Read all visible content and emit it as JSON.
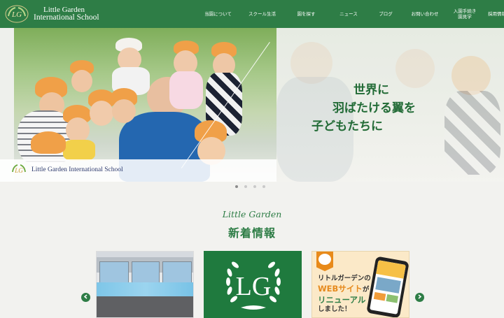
{
  "header": {
    "logo_line1": "Little Garden",
    "logo_line2": "International School",
    "background_color": "#2e7d46",
    "nav": [
      {
        "label": "当園について",
        "icon": null
      },
      {
        "label": "スクール生活",
        "icon": null
      },
      {
        "label": "園を探す",
        "icon": null
      },
      {
        "label": "ニュース",
        "icon": null
      },
      {
        "label": "ブログ",
        "icon": null
      },
      {
        "label": "お問い合わせ",
        "icon": null
      },
      {
        "label": "入園手続き\n園見学",
        "icon": null
      },
      {
        "label": "採用情報",
        "icon": "external-link-icon"
      }
    ]
  },
  "hero": {
    "copy_line1": "世界に",
    "copy_line2": "羽ばたける翼を",
    "copy_line3": "子どもたちに",
    "caption": "Little Garden International School",
    "accent_color": "#226b36"
  },
  "carousel": {
    "slide_count": 4,
    "active_index": 0
  },
  "news": {
    "subtitle": "Little Garden",
    "title": "新着情報",
    "cards": [
      {
        "kind": "photo-storefront"
      },
      {
        "kind": "logo",
        "emblem_letters": "LG"
      },
      {
        "kind": "announcement",
        "line1": "リトルガーデンの",
        "line2_highlight": "WEBサイト",
        "line2_rest": "が",
        "line3": "リニューアル",
        "line4": "しました！"
      }
    ],
    "prev_icon": "chevron-left-icon",
    "next_icon": "chevron-right-icon"
  }
}
